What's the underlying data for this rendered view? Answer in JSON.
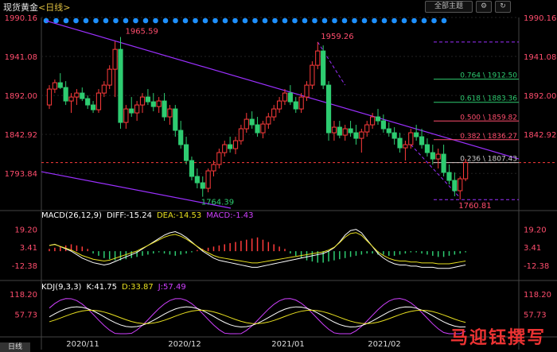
{
  "header": {
    "symbol": "现货黄金",
    "period": "<日线>",
    "theme_button": "全部主题",
    "icon_gear": "gear-icon",
    "icon_refresh": "refresh-icon"
  },
  "colors": {
    "up": "#ff3b3b",
    "down": "#2ecc71",
    "channel": "#9b30ff",
    "fib": "#ff3b3b",
    "macd_dif": "#ffffff",
    "macd_dea": "#e8e020",
    "kdj_k": "#ffffff",
    "kdj_d": "#e8e020",
    "kdj_j": "#d040ff",
    "axis_text": "#ff4d6d"
  },
  "main_indicator": {
    "labels": [
      "1990.16",
      "1941.08",
      "1892.00",
      "1842.92",
      "1793.84"
    ],
    "right_labels": [
      "1990.16",
      "1941.08",
      "1892.00",
      "1842.92"
    ]
  },
  "annotations": {
    "high1": "1965.59",
    "high2": "1959.26",
    "low1": "1764.39",
    "low2": "1760.81",
    "current": "1807.43"
  },
  "fib_levels": [
    {
      "label": "0.764 \\ 1912.50",
      "value": 1912.5,
      "color": "#2ecc71"
    },
    {
      "label": "0.618 \\ 1883.36",
      "value": 1883.36,
      "color": "#2ecc71"
    },
    {
      "label": "0.500 \\ 1859.82",
      "value": 1859.82,
      "color": "#ff4d6d"
    },
    {
      "label": "0.382 \\ 1836.27",
      "value": 1836.27,
      "color": "#ff4d6d"
    },
    {
      "label": "0.236 \\ 1807.43",
      "value": 1807.43,
      "color": "#cccccc"
    }
  ],
  "macd": {
    "title": "MACD(26,12,9)",
    "dif": "DIFF:-15.24",
    "dea": "DEA:-14.53",
    "macd": "MACD:-1.43",
    "labels": [
      "19.20",
      "3.41",
      "-12.38"
    ]
  },
  "kdj": {
    "title": "KDJ(9,3,3)",
    "k": "K:41.75",
    "d": "D:33.87",
    "j": "J:57.49",
    "labels": [
      "118.20",
      "57.73"
    ]
  },
  "xaxis": [
    "2020/11",
    "2020/12",
    "2021/01",
    "2021/02"
  ],
  "badge": "日线",
  "watermark": "马迎钰撰写",
  "chart_data": {
    "type": "candlestick",
    "title": "现货黄金 <日线>",
    "ylim": [
      1750,
      1990.16
    ],
    "yticks": [
      1990.16,
      1941.08,
      1892.0,
      1842.92,
      1793.84
    ],
    "x_ticks": [
      "2020/11",
      "2020/12",
      "2021/01",
      "2021/02"
    ],
    "candles": [
      [
        1880,
        1905,
        1875,
        1900
      ],
      [
        1900,
        1912,
        1895,
        1908
      ],
      [
        1908,
        1920,
        1900,
        1902
      ],
      [
        1902,
        1910,
        1880,
        1885
      ],
      [
        1885,
        1895,
        1870,
        1890
      ],
      [
        1890,
        1900,
        1880,
        1895
      ],
      [
        1895,
        1902,
        1885,
        1888
      ],
      [
        1888,
        1892,
        1875,
        1880
      ],
      [
        1880,
        1885,
        1870,
        1874
      ],
      [
        1874,
        1900,
        1870,
        1895
      ],
      [
        1895,
        1910,
        1890,
        1905
      ],
      [
        1905,
        1930,
        1900,
        1925
      ],
      [
        1925,
        1960,
        1890,
        1950
      ],
      [
        1950,
        1965.59,
        1850,
        1858
      ],
      [
        1858,
        1880,
        1850,
        1875
      ],
      [
        1875,
        1890,
        1865,
        1870
      ],
      [
        1870,
        1885,
        1860,
        1880
      ],
      [
        1880,
        1895,
        1870,
        1890
      ],
      [
        1890,
        1900,
        1880,
        1884
      ],
      [
        1884,
        1895,
        1872,
        1878
      ],
      [
        1878,
        1890,
        1870,
        1885
      ],
      [
        1885,
        1895,
        1860,
        1865
      ],
      [
        1865,
        1880,
        1855,
        1875
      ],
      [
        1875,
        1880,
        1840,
        1848
      ],
      [
        1848,
        1860,
        1825,
        1830
      ],
      [
        1830,
        1840,
        1805,
        1810
      ],
      [
        1810,
        1815,
        1785,
        1790
      ],
      [
        1790,
        1800,
        1775,
        1782
      ],
      [
        1782,
        1790,
        1764.39,
        1775
      ],
      [
        1775,
        1800,
        1770,
        1797
      ],
      [
        1797,
        1810,
        1790,
        1805
      ],
      [
        1805,
        1825,
        1800,
        1820
      ],
      [
        1820,
        1835,
        1815,
        1830
      ],
      [
        1830,
        1840,
        1820,
        1825
      ],
      [
        1825,
        1840,
        1818,
        1835
      ],
      [
        1835,
        1855,
        1830,
        1850
      ],
      [
        1850,
        1870,
        1845,
        1862
      ],
      [
        1862,
        1872,
        1850,
        1855
      ],
      [
        1855,
        1865,
        1840,
        1845
      ],
      [
        1845,
        1860,
        1838,
        1856
      ],
      [
        1856,
        1870,
        1850,
        1865
      ],
      [
        1865,
        1880,
        1860,
        1875
      ],
      [
        1875,
        1890,
        1870,
        1885
      ],
      [
        1885,
        1900,
        1880,
        1895
      ],
      [
        1895,
        1905,
        1880,
        1884
      ],
      [
        1884,
        1890,
        1870,
        1875
      ],
      [
        1875,
        1895,
        1870,
        1890
      ],
      [
        1890,
        1910,
        1885,
        1905
      ],
      [
        1905,
        1935,
        1900,
        1930
      ],
      [
        1930,
        1959.26,
        1925,
        1948
      ],
      [
        1948,
        1955,
        1900,
        1905
      ],
      [
        1905,
        1910,
        1835,
        1845
      ],
      [
        1845,
        1860,
        1835,
        1852
      ],
      [
        1852,
        1860,
        1838,
        1842
      ],
      [
        1842,
        1855,
        1835,
        1850
      ],
      [
        1850,
        1860,
        1840,
        1845
      ],
      [
        1845,
        1855,
        1830,
        1838
      ],
      [
        1838,
        1850,
        1820,
        1846
      ],
      [
        1846,
        1860,
        1840,
        1855
      ],
      [
        1855,
        1870,
        1850,
        1865
      ],
      [
        1865,
        1875,
        1855,
        1860
      ],
      [
        1860,
        1868,
        1845,
        1850
      ],
      [
        1850,
        1858,
        1840,
        1845
      ],
      [
        1845,
        1852,
        1830,
        1838
      ],
      [
        1838,
        1845,
        1820,
        1826
      ],
      [
        1826,
        1835,
        1810,
        1830
      ],
      [
        1830,
        1850,
        1825,
        1845
      ],
      [
        1845,
        1855,
        1835,
        1840
      ],
      [
        1840,
        1850,
        1825,
        1830
      ],
      [
        1830,
        1838,
        1815,
        1820
      ],
      [
        1820,
        1830,
        1805,
        1812
      ],
      [
        1812,
        1825,
        1800,
        1818
      ],
      [
        1818,
        1830,
        1790,
        1795
      ],
      [
        1795,
        1805,
        1780,
        1785
      ],
      [
        1785,
        1795,
        1765,
        1772
      ],
      [
        1772,
        1790,
        1760.81,
        1787
      ],
      [
        1787,
        1812,
        1784,
        1807.43
      ]
    ],
    "fib_levels": [
      1912.5,
      1883.36,
      1859.82,
      1836.27,
      1807.43
    ],
    "macd": {
      "ylim": [
        -20,
        25
      ],
      "yticks": [
        19.2,
        3.41,
        -12.38
      ],
      "dif": -15.24,
      "dea": -14.53,
      "macd": -1.43
    },
    "kdj": {
      "ylim": [
        0,
        130
      ],
      "yticks": [
        118.2,
        57.73
      ],
      "k": 41.75,
      "d": 33.87,
      "j": 57.49
    }
  }
}
